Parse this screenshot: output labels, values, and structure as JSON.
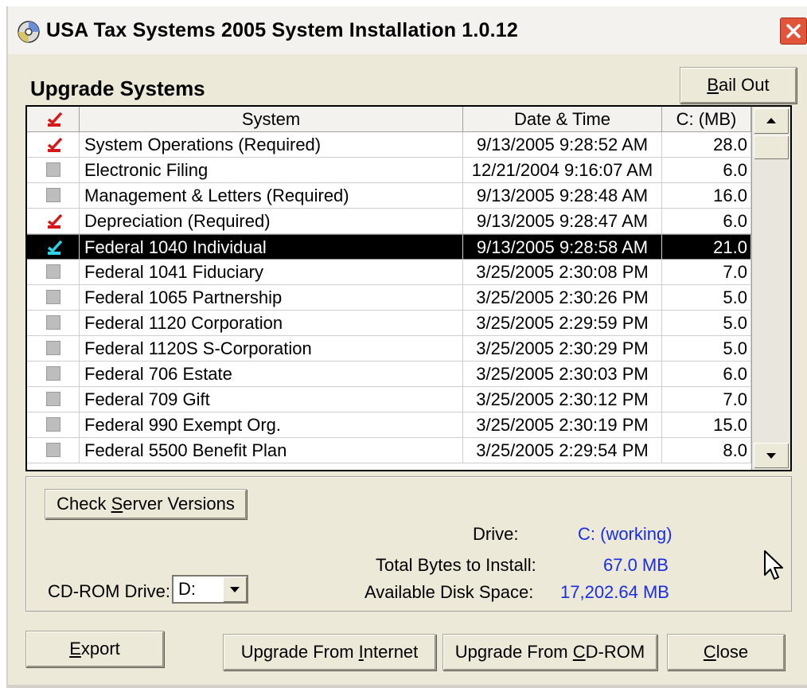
{
  "window": {
    "title": "USA Tax Systems 2005 System Installation 1.0.12"
  },
  "heading": "Upgrade Systems",
  "buttons": {
    "bail_out": {
      "prefix": "",
      "key": "B",
      "suffix": "ail Out"
    },
    "check_server": {
      "prefix": "Check ",
      "key": "S",
      "suffix": "erver Versions"
    },
    "export": {
      "prefix": "",
      "key": "E",
      "suffix": "xport"
    },
    "upgrade_internet": {
      "prefix": "Upgrade From ",
      "key": "I",
      "suffix": "nternet"
    },
    "upgrade_cd": {
      "prefix": "Upgrade From ",
      "key": "C",
      "suffix": "D-ROM"
    },
    "close": {
      "prefix": "",
      "key": "C",
      "suffix": "lose"
    }
  },
  "table": {
    "headers": {
      "system": "System",
      "date": "Date & Time",
      "size": "C: (MB)"
    },
    "header_checked": true,
    "rows": [
      {
        "checked": true,
        "system": "System Operations (Required)",
        "date": "9/13/2005 9:28:52 AM",
        "size": "28.0",
        "selected": false
      },
      {
        "checked": false,
        "system": "Electronic Filing",
        "date": "12/21/2004 9:16:07 AM",
        "size": "6.0",
        "selected": false
      },
      {
        "checked": false,
        "system": "Management & Letters (Required)",
        "date": "9/13/2005 9:28:48 AM",
        "size": "16.0",
        "selected": false
      },
      {
        "checked": true,
        "system": "Depreciation (Required)",
        "date": "9/13/2005 9:28:47 AM",
        "size": "6.0",
        "selected": false
      },
      {
        "checked": true,
        "system": "Federal 1040 Individual",
        "date": "9/13/2005 9:28:58 AM",
        "size": "21.0",
        "selected": true
      },
      {
        "checked": false,
        "system": "Federal 1041 Fiduciary",
        "date": "3/25/2005 2:30:08 PM",
        "size": "7.0",
        "selected": false
      },
      {
        "checked": false,
        "system": "Federal 1065 Partnership",
        "date": "3/25/2005 2:30:26 PM",
        "size": "5.0",
        "selected": false
      },
      {
        "checked": false,
        "system": "Federal 1120 Corporation",
        "date": "3/25/2005 2:29:59 PM",
        "size": "5.0",
        "selected": false
      },
      {
        "checked": false,
        "system": "Federal 1120S S-Corporation",
        "date": "3/25/2005 2:30:29 PM",
        "size": "5.0",
        "selected": false
      },
      {
        "checked": false,
        "system": "Federal 706 Estate",
        "date": "3/25/2005 2:30:03 PM",
        "size": "6.0",
        "selected": false
      },
      {
        "checked": false,
        "system": "Federal 709 Gift",
        "date": "3/25/2005 2:30:12 PM",
        "size": "7.0",
        "selected": false
      },
      {
        "checked": false,
        "system": "Federal 990 Exempt Org.",
        "date": "3/25/2005 2:30:19 PM",
        "size": "15.0",
        "selected": false
      },
      {
        "checked": false,
        "system": "Federal 5500 Benefit Plan",
        "date": "3/25/2005 2:29:54 PM",
        "size": "8.0",
        "selected": false
      }
    ]
  },
  "info": {
    "drive_label": "Drive:",
    "drive_value": "C: (working)",
    "total_label": "Total Bytes to Install:",
    "total_value": "67.0 MB",
    "avail_label": "Available Disk Space:",
    "avail_value": "17,202.64 MB"
  },
  "cdrom": {
    "label": "CD-ROM Drive:",
    "value": "D:"
  },
  "colors": {
    "check_red": "#d81818",
    "check_cyan": "#2fd0e8",
    "info_blue": "#1a2ee0"
  },
  "icons": {
    "app": "cd-disc-icon",
    "close": "close-icon",
    "cursor": "mouse-pointer-icon"
  }
}
